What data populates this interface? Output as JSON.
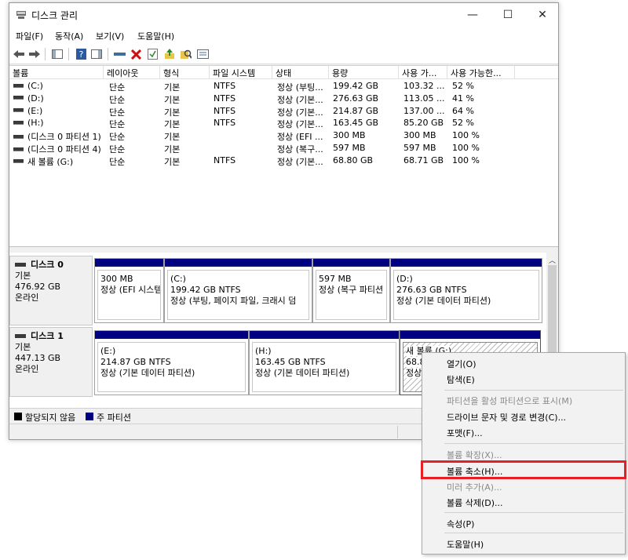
{
  "window": {
    "title": "디스크 관리",
    "minimize": "—",
    "maximize": "☐",
    "close": "✕"
  },
  "menu": [
    "파일(F)",
    "동작(A)",
    "보기(V)",
    "도움말(H)"
  ],
  "toolbar": [
    "back-icon",
    "forward-icon",
    "console-tree-icon",
    "help-icon",
    "action-pane-icon",
    "connect-icon",
    "delete-icon",
    "checklist-icon",
    "export-icon",
    "search-icon",
    "properties-icon"
  ],
  "columns": [
    "볼륨",
    "레이아웃",
    "형식",
    "파일 시스템",
    "상태",
    "용량",
    "사용 가...",
    "사용 가능한..."
  ],
  "volumes": [
    [
      "(C:)",
      "단순",
      "기본",
      "NTFS",
      "정상 (부팅...",
      "199.42 GB",
      "103.32 ...",
      "52 %"
    ],
    [
      "(D:)",
      "단순",
      "기본",
      "NTFS",
      "정상 (기본...",
      "276.63 GB",
      "113.05 ...",
      "41 %"
    ],
    [
      "(E:)",
      "단순",
      "기본",
      "NTFS",
      "정상 (기본...",
      "214.87 GB",
      "137.00 ...",
      "64 %"
    ],
    [
      "(H:)",
      "단순",
      "기본",
      "NTFS",
      "정상 (기본...",
      "163.45 GB",
      "85.20 GB",
      "52 %"
    ],
    [
      "(디스크 0 파티션 1)",
      "단순",
      "기본",
      "",
      "정상 (EFI ...",
      "300 MB",
      "300 MB",
      "100 %"
    ],
    [
      "(디스크 0 파티션 4)",
      "단순",
      "기본",
      "",
      "정상 (복구...",
      "597 MB",
      "597 MB",
      "100 %"
    ],
    [
      "새 볼륨 (G:)",
      "단순",
      "기본",
      "NTFS",
      "정상 (기본...",
      "68.80 GB",
      "68.71 GB",
      "100 %"
    ]
  ],
  "disks": [
    {
      "name": "디스크 0",
      "type": "기본",
      "size": "476.92 GB",
      "state": "온라인",
      "partitions": [
        {
          "title": "",
          "size": "300 MB",
          "status": "정상 (EFI 시스템"
        },
        {
          "title": "(C:)",
          "size": "199.42 GB NTFS",
          "status": "정상 (부팅, 페이지 파일, 크래시 덤"
        },
        {
          "title": "",
          "size": "597 MB",
          "status": "정상 (복구 파티션"
        },
        {
          "title": "(D:)",
          "size": "276.63 GB NTFS",
          "status": "정상 (기본 데이터 파티션)"
        }
      ]
    },
    {
      "name": "디스크 1",
      "type": "기본",
      "size": "447.13 GB",
      "state": "온라인",
      "partitions": [
        {
          "title": "(E:)",
          "size": "214.87 GB NTFS",
          "status": "정상 (기본 데이터 파티션)"
        },
        {
          "title": "(H:)",
          "size": "163.45 GB NTFS",
          "status": "정상 (기본 데이터 파티션)"
        },
        {
          "title": "새 볼륨  (G:)",
          "size": "68.8",
          "status": "정상"
        }
      ]
    }
  ],
  "legend": {
    "unallocated": "할당되지 않음",
    "primary": "주 파티션",
    "unallocated_color": "#000000",
    "primary_color": "#000080"
  },
  "context_menu": [
    {
      "label": "열기(O)",
      "disabled": false
    },
    {
      "label": "탐색(E)",
      "disabled": false
    },
    {
      "label": "파티션을 활성 파티션으로 표시(M)",
      "disabled": true
    },
    {
      "label": "드라이브 문자 및 경로 변경(C)...",
      "disabled": false
    },
    {
      "label": "포맷(F)...",
      "disabled": false
    },
    {
      "label": "볼륨 확장(X)...",
      "disabled": true
    },
    {
      "label": "볼륨 축소(H)...",
      "disabled": false
    },
    {
      "label": "미러 추가(A)...",
      "disabled": true
    },
    {
      "label": "볼륨 삭제(D)...",
      "disabled": false
    },
    {
      "label": "속성(P)",
      "disabled": false
    },
    {
      "label": "도움말(H)",
      "disabled": false
    }
  ],
  "highlight_color": "#e81e25"
}
